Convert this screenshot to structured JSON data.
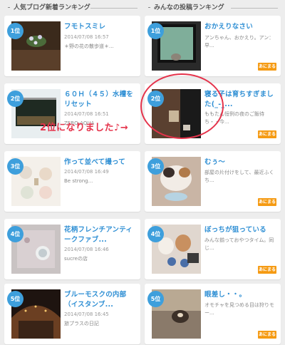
{
  "left_section": {
    "title": "人気ブログ新着ランキング"
  },
  "right_section": {
    "title": "みんなの投稿ランキング"
  },
  "left_items": [
    {
      "rank": "1位",
      "title": "フモトスミレ",
      "date": "2014/07/08 16:57",
      "desc": "＊野の花の散歩道＊..."
    },
    {
      "rank": "2位",
      "title": "６０Ｈ（４５）水槽をリセット",
      "date": "2014/07/08 16:51",
      "desc": "ZERO-AQUA"
    },
    {
      "rank": "3位",
      "title": "作って並べて撮って",
      "date": "2014/07/08 16:49",
      "desc": "Be strong..."
    },
    {
      "rank": "4位",
      "title": "花柄フレンチアンティークファブ...",
      "date": "2014/07/08 16:46",
      "desc": "sucreの店"
    },
    {
      "rank": "5位",
      "title": "ブルーモスクの内部（イスタンブ...",
      "date": "2014/07/08 16:45",
      "desc": "旅プラスの日記"
    }
  ],
  "right_items": [
    {
      "rank": "1位",
      "title": "おかえりなさい",
      "desc": "アンちゃん、おかえり。アン：早...",
      "ameba": "あにまる"
    },
    {
      "rank": "2位",
      "title": "寝る子は育ちすぎました(_-_...",
      "desc": "ももたん恒例の夜のご飯待ち・・今...",
      "ameba": "あにまる"
    },
    {
      "rank": "3位",
      "title": "むぅ～",
      "desc": "部屋の片付けをして、最近ふくち...",
      "ameba": "あにまる"
    },
    {
      "rank": "4位",
      "title": "ぼっちが狙っている",
      "desc": "みんな揃っておやつタイム。同じ...",
      "ameba": "あにまる"
    },
    {
      "rank": "5位",
      "title": "眼差し・・。",
      "desc": "オモチャを見つめる目は狩りモー...",
      "ameba": "あにまる"
    }
  ],
  "annotation": {
    "text": "2位になりました♪→"
  },
  "colors": {
    "accent": "#3e9fdc",
    "title_blue": "#2f8fd4",
    "highlight_red": "#e5334b",
    "ameba_orange": "#f59a12"
  }
}
